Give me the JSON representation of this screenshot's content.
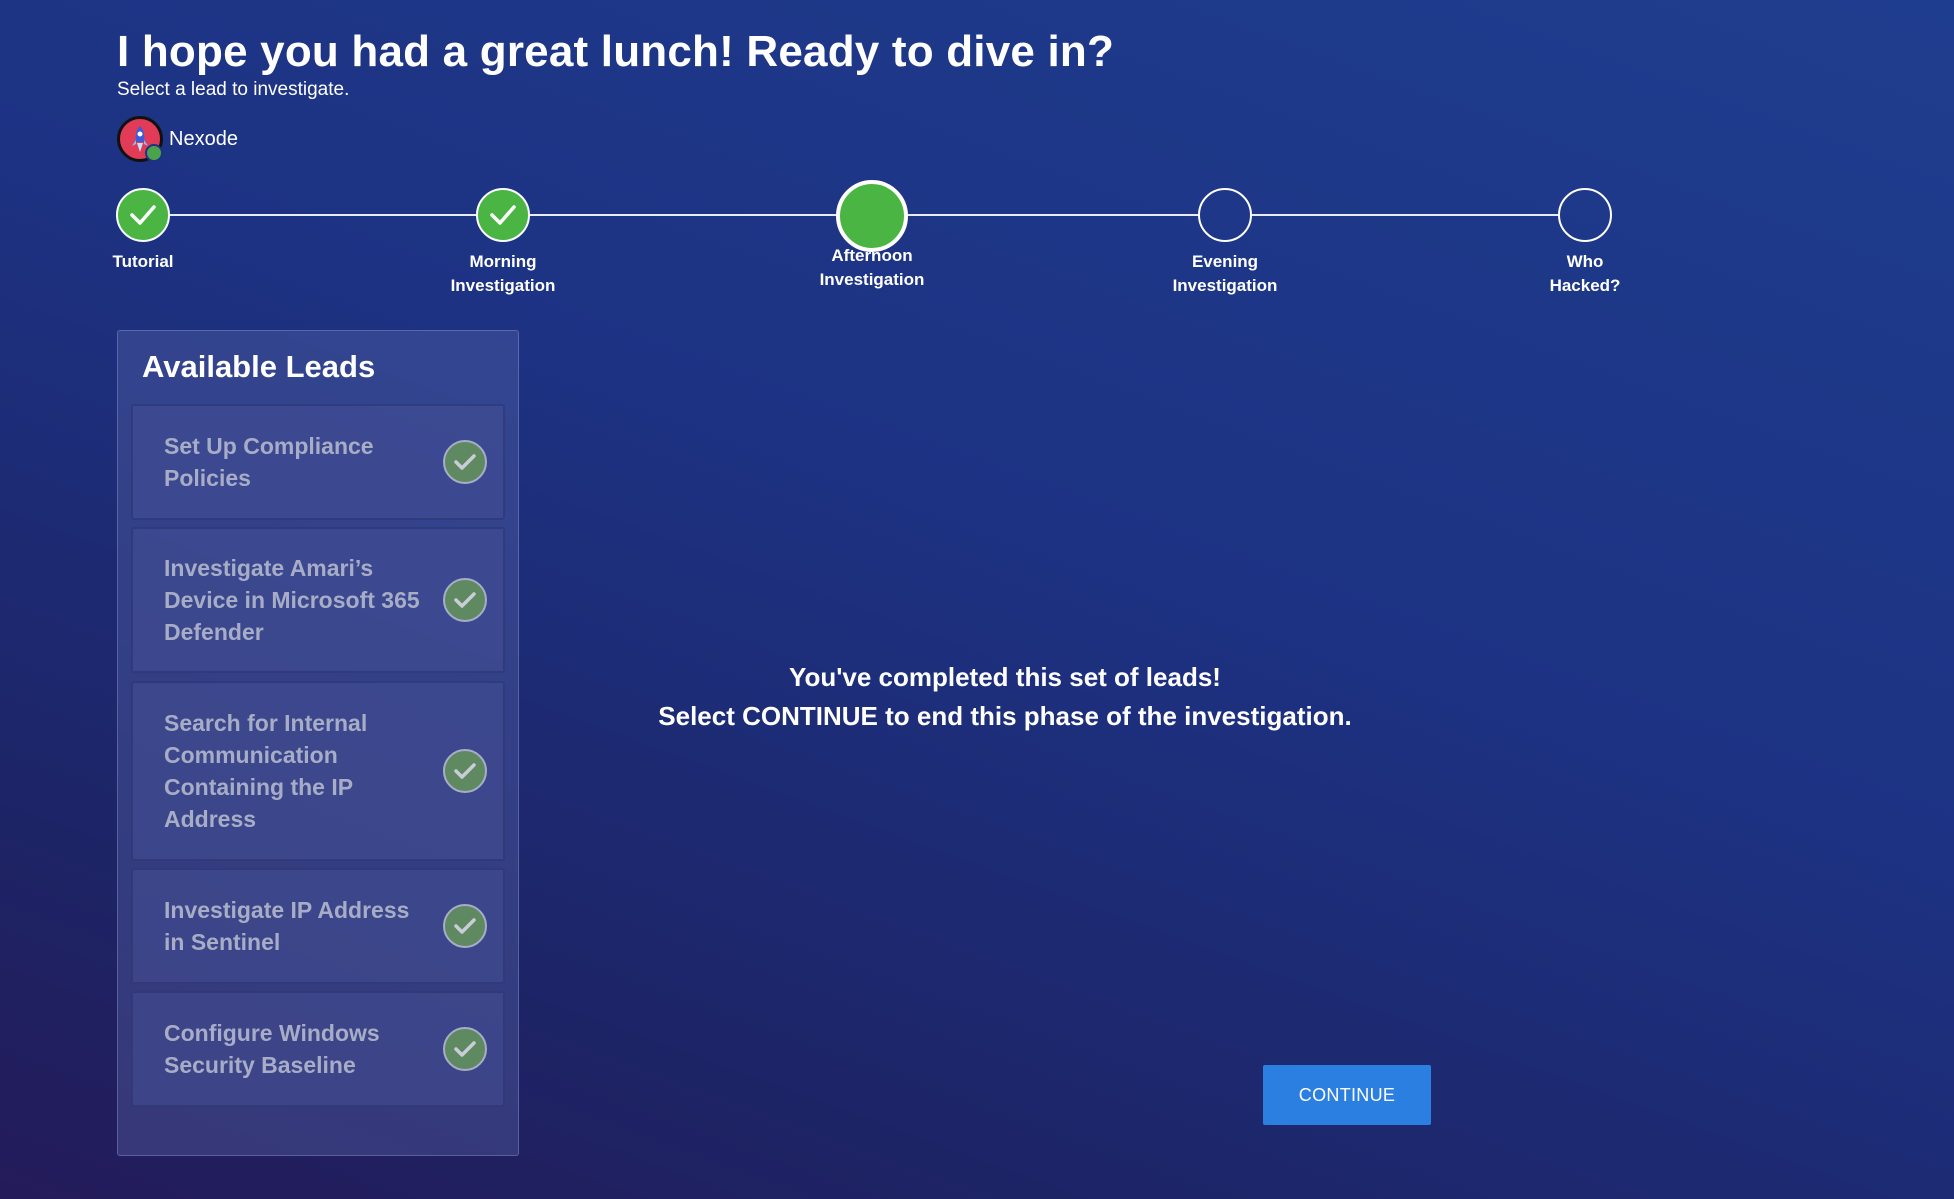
{
  "header": {
    "title": "I hope you had a great lunch! Ready to dive in?",
    "subtitle": "Select a lead to investigate."
  },
  "org": {
    "name": "Nexode",
    "avatar_icon": "rocket-icon",
    "presence": "online"
  },
  "stepper": {
    "steps": [
      {
        "label": "Tutorial",
        "status": "completed"
      },
      {
        "label": "Morning\nInvestigation",
        "status": "completed"
      },
      {
        "label": "Afternoon\nInvestigation",
        "status": "current"
      },
      {
        "label": "Evening\nInvestigation",
        "status": "upcoming"
      },
      {
        "label": "Who\nHacked?",
        "status": "upcoming"
      }
    ]
  },
  "leads": {
    "title": "Available Leads",
    "items": [
      {
        "label": "Set Up Compliance Policies",
        "status": "completed"
      },
      {
        "label": "Investigate Amari’s Device in Microsoft 365 Defender",
        "status": "completed"
      },
      {
        "label": "Search for Internal Communication Containing the IP Address",
        "status": "completed"
      },
      {
        "label": "Investigate IP Address in Sentinel",
        "status": "completed"
      },
      {
        "label": "Configure Windows Security Baseline",
        "status": "completed"
      }
    ]
  },
  "completion": {
    "line1": "You've completed this set of leads!",
    "line2": "Select CONTINUE to end this phase of the investigation."
  },
  "actions": {
    "continue_label": "CONTINUE"
  },
  "colors": {
    "accent_green": "#4bb543",
    "button_blue": "#2b7fe0",
    "muted_text": "#a7adc7"
  }
}
